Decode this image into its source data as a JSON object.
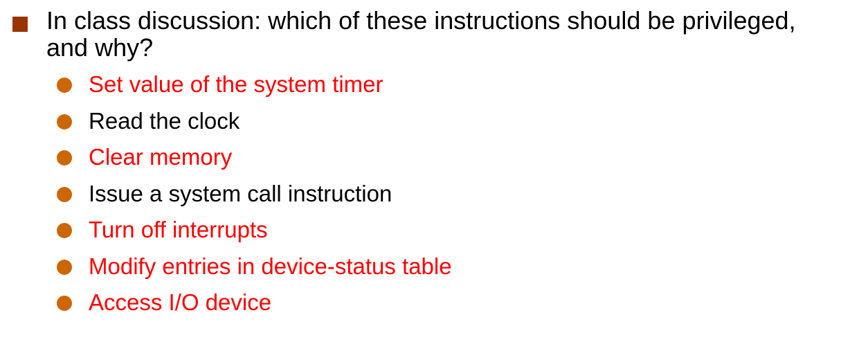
{
  "colors": {
    "main_bullet": "#993300",
    "sub_bullet": "#cc6600",
    "highlight": "#ff0000",
    "normal": "#000000"
  },
  "main_bullet": {
    "text": "In class discussion: which of these instructions should be privileged, and why?"
  },
  "items": [
    {
      "text": "Set value of the system timer",
      "privileged": true
    },
    {
      "text": "Read the clock",
      "privileged": false
    },
    {
      "text": "Clear memory",
      "privileged": true
    },
    {
      "text": "Issue a system call instruction",
      "privileged": false
    },
    {
      "text": "Turn off interrupts",
      "privileged": true
    },
    {
      "text": "Modify entries in device-status table",
      "privileged": true
    },
    {
      "text": "Access I/O device",
      "privileged": true
    }
  ]
}
